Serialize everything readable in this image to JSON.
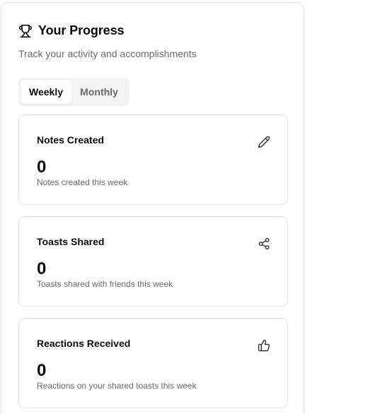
{
  "header": {
    "title": "Your Progress",
    "subtitle": "Track your activity and accomplishments",
    "icon": "trophy-icon"
  },
  "tabs": [
    {
      "label": "Weekly",
      "active": true
    },
    {
      "label": "Monthly",
      "active": false
    }
  ],
  "cards": [
    {
      "label": "Notes Created",
      "value": "0",
      "description": "Notes created this week",
      "icon": "pencil-icon"
    },
    {
      "label": "Toasts Shared",
      "value": "0",
      "description": "Toasts shared with friends this week",
      "icon": "share-icon"
    },
    {
      "label": "Reactions Received",
      "value": "0",
      "description": "Reactions on your shared toasts this week",
      "icon": "thumbs-up-icon"
    }
  ],
  "colors": {
    "text": "#0a0a0a",
    "muted": "#6b6b6b",
    "border": "#e5e5e5",
    "tab_bg": "#f3f3f3"
  }
}
